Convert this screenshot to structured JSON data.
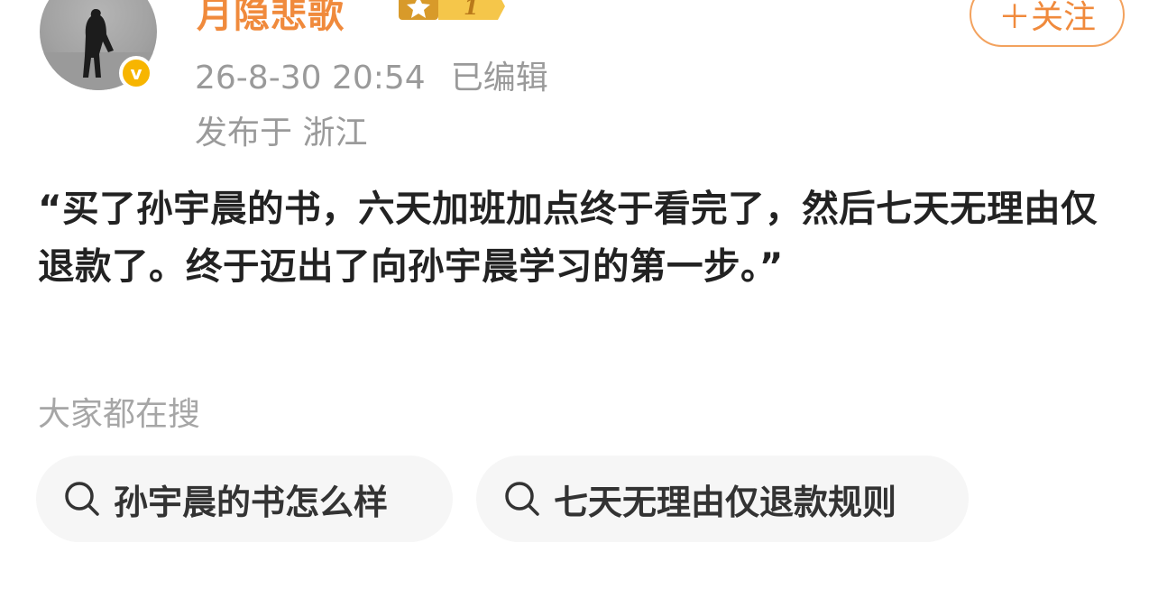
{
  "author": {
    "name": "月隐悲歌",
    "level_badge": "1",
    "verified_mark": "v"
  },
  "follow_button": {
    "label": "＋关注"
  },
  "post_meta": {
    "time": "26-8-30 20:54",
    "edited": "已编辑",
    "location": "发布于 浙江"
  },
  "post": {
    "text": "“买了孙宇晨的书，六天加班加点终于看完了，然后七天无理由仅退款了。终于迈出了向孙宇晨学习的第一步。”"
  },
  "hot_search": {
    "heading": "大家都在搜",
    "items": [
      {
        "label": "孙宇晨的书怎么样",
        "icon": "search-icon"
      },
      {
        "label": "七天无理由仅退款规则",
        "icon": "search-icon"
      }
    ]
  },
  "colors": {
    "accent": "#f08a3c",
    "verified": "#f7b500",
    "meta_text": "#9a9a9a",
    "body_text": "#222222",
    "chip_bg": "#f6f6f6"
  }
}
